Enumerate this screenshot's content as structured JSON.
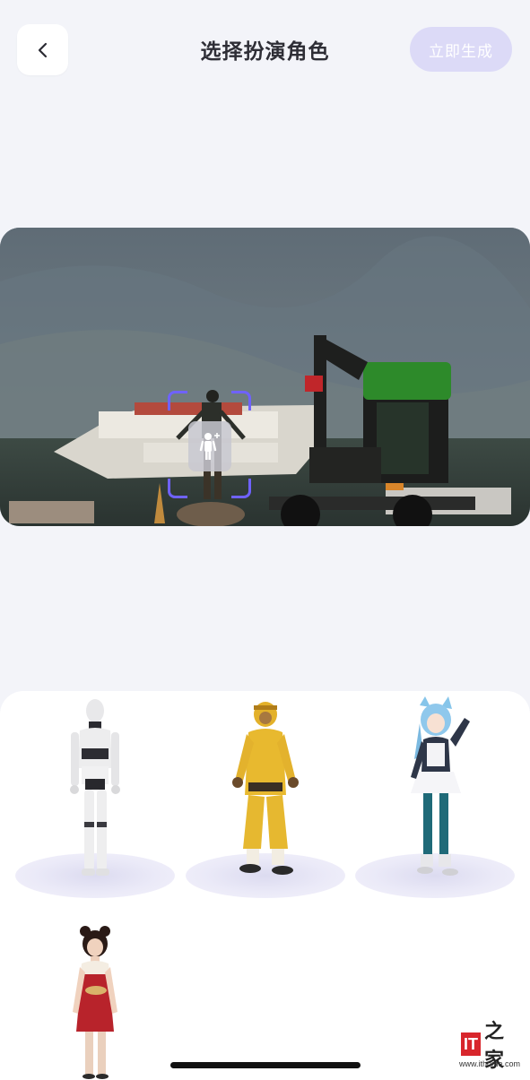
{
  "header": {
    "title": "选择扮演角色",
    "generate_label": "立即生成",
    "generate_color": "#dcdaf7",
    "back_icon": "chevron-left-icon"
  },
  "preview": {
    "selection_color": "#6f62ff",
    "selection_icon": "add-person-icon"
  },
  "characters": [
    {
      "id": "robot"
    },
    {
      "id": "monkey-king"
    },
    {
      "id": "anime-girl"
    },
    {
      "id": "qipao-girl"
    }
  ],
  "watermark": {
    "logo_text": "IT",
    "logo_char": "之家",
    "url": "www.ithome.com"
  }
}
